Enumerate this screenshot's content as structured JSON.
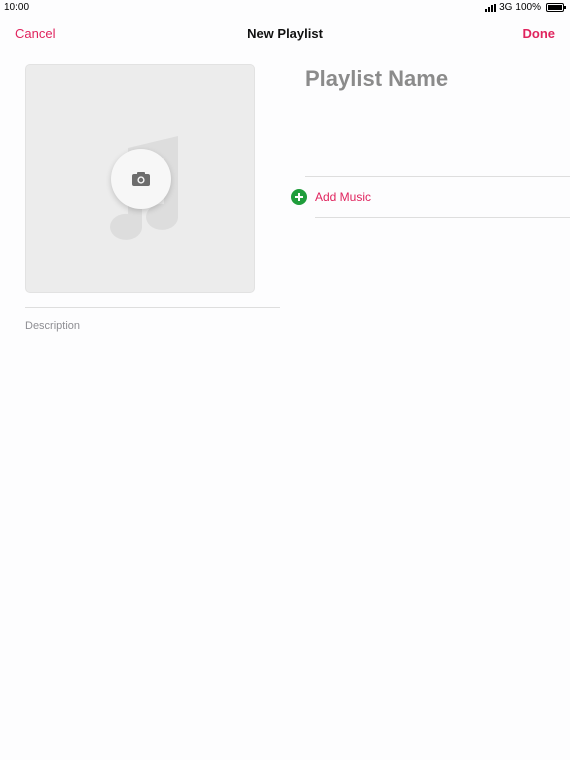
{
  "status_bar": {
    "time": "10:00",
    "network": "3G",
    "battery": "100%"
  },
  "nav": {
    "cancel_label": "Cancel",
    "title": "New Playlist",
    "done_label": "Done"
  },
  "artwork": {
    "placeholder_icon": "music-note-icon",
    "camera_icon": "camera-icon"
  },
  "playlist": {
    "name_placeholder": "Playlist Name",
    "description_placeholder": "Description"
  },
  "add_music": {
    "label": "Add Music",
    "icon": "plus-circle-icon"
  },
  "colors": {
    "accent": "#e0245e",
    "add_icon": "#1f9d3b"
  }
}
